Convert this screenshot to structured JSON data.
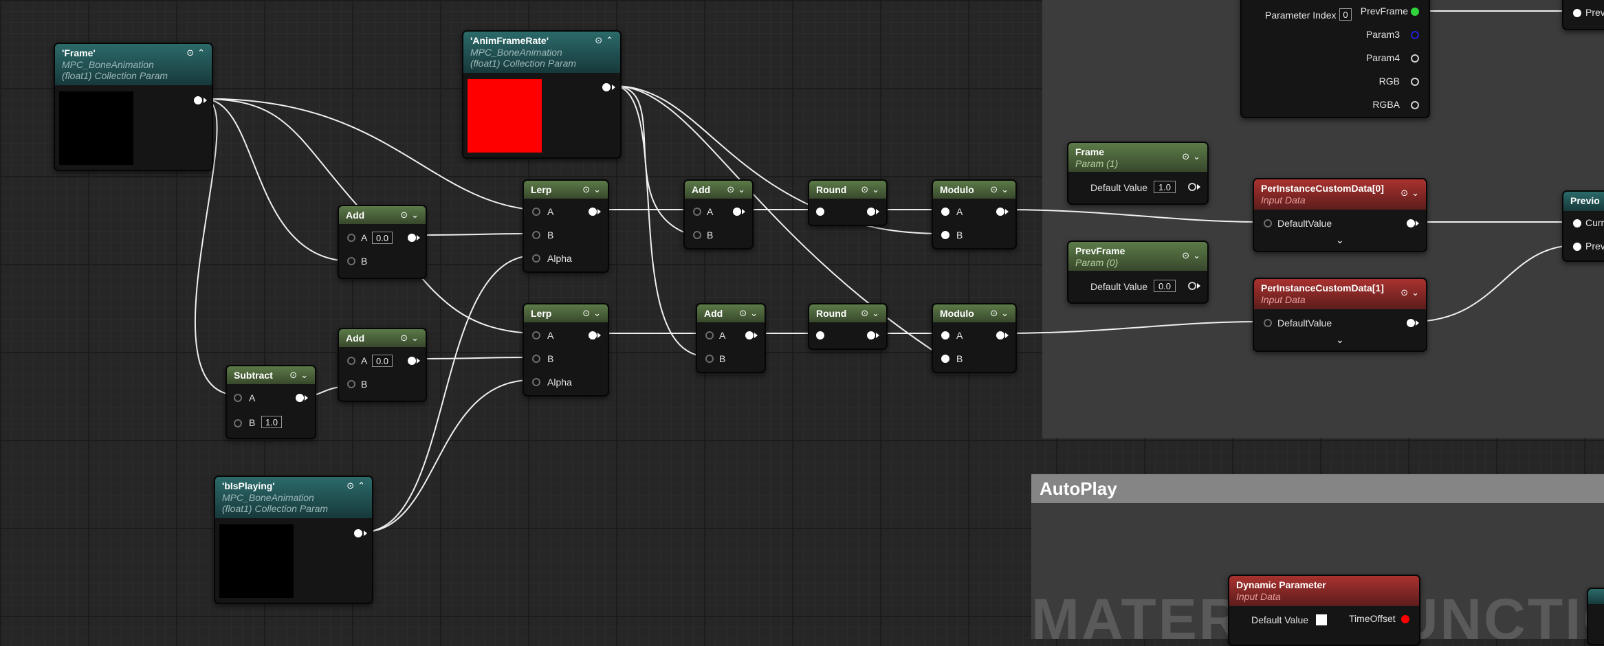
{
  "graph": {
    "nodes": {
      "frame": {
        "title": "'Frame'",
        "sub1": "MPC_BoneAnimation",
        "sub2": "(float1) Collection Param",
        "preview_color": "#000000"
      },
      "anim_frame_rate": {
        "title": "'AnimFrameRate'",
        "sub1": "MPC_BoneAnimation",
        "sub2": "(float1) Collection Param",
        "preview_color": "#ff0000"
      },
      "b_is_playing": {
        "title": "'bIsPlaying'",
        "sub1": "MPC_BoneAnimation",
        "sub2": "(float1) Collection Param",
        "preview_color": "#000000"
      },
      "add_top": {
        "title": "Add",
        "pin_a": "A",
        "pin_a_value": "0.0",
        "pin_b": "B"
      },
      "add_bottom": {
        "title": "Add",
        "pin_a": "A",
        "pin_a_value": "0.0",
        "pin_b": "B"
      },
      "subtract": {
        "title": "Subtract",
        "pin_a": "A",
        "pin_b": "B",
        "pin_b_value": "1.0"
      },
      "lerp_top": {
        "title": "Lerp",
        "pin_a": "A",
        "pin_b": "B",
        "pin_alpha": "Alpha"
      },
      "lerp_bottom": {
        "title": "Lerp",
        "pin_a": "A",
        "pin_b": "B",
        "pin_alpha": "Alpha"
      },
      "add2_top": {
        "title": "Add",
        "pin_a": "A",
        "pin_b": "B"
      },
      "add2_bottom": {
        "title": "Add",
        "pin_a": "A",
        "pin_b": "B"
      },
      "round_top": {
        "title": "Round"
      },
      "round_bottom": {
        "title": "Round"
      },
      "modulo_top": {
        "title": "Modulo",
        "pin_a": "A",
        "pin_b": "B"
      },
      "modulo_bottom": {
        "title": "Modulo",
        "pin_a": "A",
        "pin_b": "B"
      },
      "param_frame": {
        "title": "Frame",
        "sub": "Param (1)",
        "default_label": "Default Value",
        "default_value": "1.0"
      },
      "param_prev_frame": {
        "title": "PrevFrame",
        "sub": "Param (0)",
        "default_label": "Default Value",
        "default_value": "0.0"
      },
      "custom_data_0": {
        "title": "PerInstanceCustomData[0]",
        "sub": "Input Data",
        "pin": "DefaultValue"
      },
      "custom_data_1": {
        "title": "PerInstanceCustomData[1]",
        "sub": "Input Data",
        "pin": "DefaultValue"
      },
      "collection_param": {
        "param_index_label": "Parameter Index",
        "param_index_value": "0",
        "outputs": [
          "PrevFrame",
          "Param3",
          "Param4",
          "RGB",
          "RGBA"
        ]
      },
      "far_top": {
        "pin": "Prev"
      },
      "far_previous": {
        "title": "Previo",
        "pin1": "Curr",
        "pin2": "Prev"
      },
      "dynamic_parameter": {
        "title": "Dynamic Parameter",
        "sub": "Input Data",
        "default_label": "Default Value",
        "pin": "TimeOffset"
      }
    },
    "comments": {
      "autoplay": {
        "title": "AutoPlay",
        "watermark": "MATERIAL FUNCTION"
      }
    },
    "colors": {
      "wire": "#ffffff",
      "exec_green": "#2fd53a",
      "pin_red": "#ff0000",
      "pin_blue": "#2020d8"
    }
  }
}
